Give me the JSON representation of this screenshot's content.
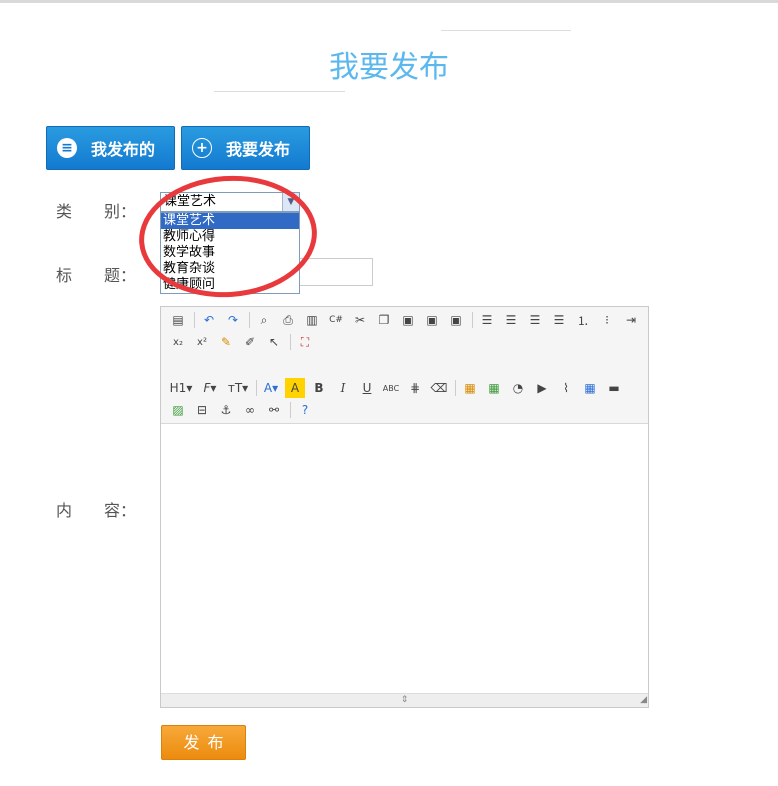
{
  "page": {
    "title": "我要发布"
  },
  "tabs": {
    "mine_label": "我发布的",
    "post_label": "我要发布"
  },
  "form": {
    "category_label": "类　　别：",
    "title_label": "标　　题：",
    "content_label": "内　　容：",
    "category_selected": "课堂艺术",
    "category_options": [
      "课堂艺术",
      "教师心得",
      "数学故事",
      "教育杂谈",
      "健康顾问"
    ],
    "submit_label": "发布"
  },
  "editor": {
    "toolbar_row1": [
      "source-icon",
      "undo-icon",
      "redo-icon",
      "preview-icon",
      "print-icon",
      "template-icon",
      "code-icon",
      "cut-icon",
      "copy-icon",
      "paste-icon",
      "paste-text-icon",
      "paste-word-icon",
      "align-left-icon",
      "align-center-icon",
      "align-right-icon",
      "justify-icon",
      "ordered-list-icon",
      "unordered-list-icon",
      "indent-icon"
    ],
    "toolbar_row2": [
      "subscript-icon",
      "superscript-icon",
      "clear-format-icon",
      "select-all-icon",
      "select-icon",
      "fullscreen-icon"
    ],
    "toolbar_row3": [
      "heading-icon",
      "font-family-icon",
      "font-size-icon",
      "font-color-icon",
      "highlight-icon",
      "bold-icon",
      "italic-icon",
      "underline-icon",
      "strikethrough-icon",
      "horizontal-rule-icon",
      "eraser-icon",
      "image-icon",
      "multi-image-icon",
      "flash-icon",
      "media-icon",
      "attach-icon",
      "table-icon",
      "hr-icon"
    ],
    "toolbar_row4": [
      "emoticon-icon",
      "pagebreak-icon",
      "anchor-icon",
      "link-icon",
      "unlink-icon",
      "help-icon"
    ]
  },
  "colors": {
    "title": "#5bb8ee",
    "tab_button": "#137ad0",
    "submit": "#ec8b0e",
    "annotation": "#e8393d",
    "selected_option": "#316ac5"
  }
}
